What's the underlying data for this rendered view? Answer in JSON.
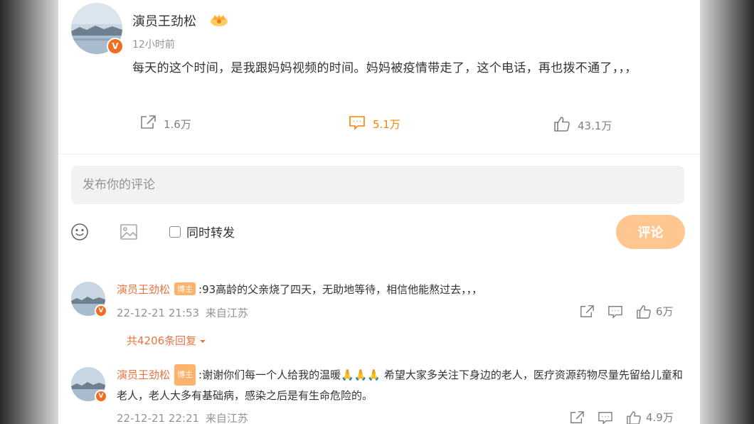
{
  "post": {
    "author": "演员王劲松",
    "time": "12小时前",
    "content": "每天的这个时间，是我跟妈妈视频的时间。妈妈被疫情带走了，这个电话，再也拨不通了，，，",
    "share_count": "1.6万",
    "comment_count": "5.1万",
    "like_count": "43.1万"
  },
  "composer": {
    "placeholder": "发布你的评论",
    "repost_label": "同时转发",
    "submit_label": "评论"
  },
  "comments": [
    {
      "author": "演员王劲松",
      "badge": "博主",
      "text": ":93高龄的父亲烧了四天，无助地等待，相信他能熬过去，，，",
      "time": "22-12-21 21:53",
      "source": "来自江苏",
      "like_count": "6万",
      "replies_label": "共4206条回复"
    },
    {
      "author": "演员王劲松",
      "badge": "博主",
      "text": ":谢谢你们每一个人给我的温暖🙏🙏🙏 希望大家多关注下身边的老人，医疗资源药物尽量先留给儿童和老人，老人大多有基础病，感染之后是有生命危险的。",
      "time": "22-12-21 22:21",
      "source": "来自江苏",
      "like_count": "4.9万"
    }
  ],
  "colors": {
    "accent": "#ff8200",
    "name_orange": "#eb7340",
    "submit_disabled": "#ffc68f"
  }
}
